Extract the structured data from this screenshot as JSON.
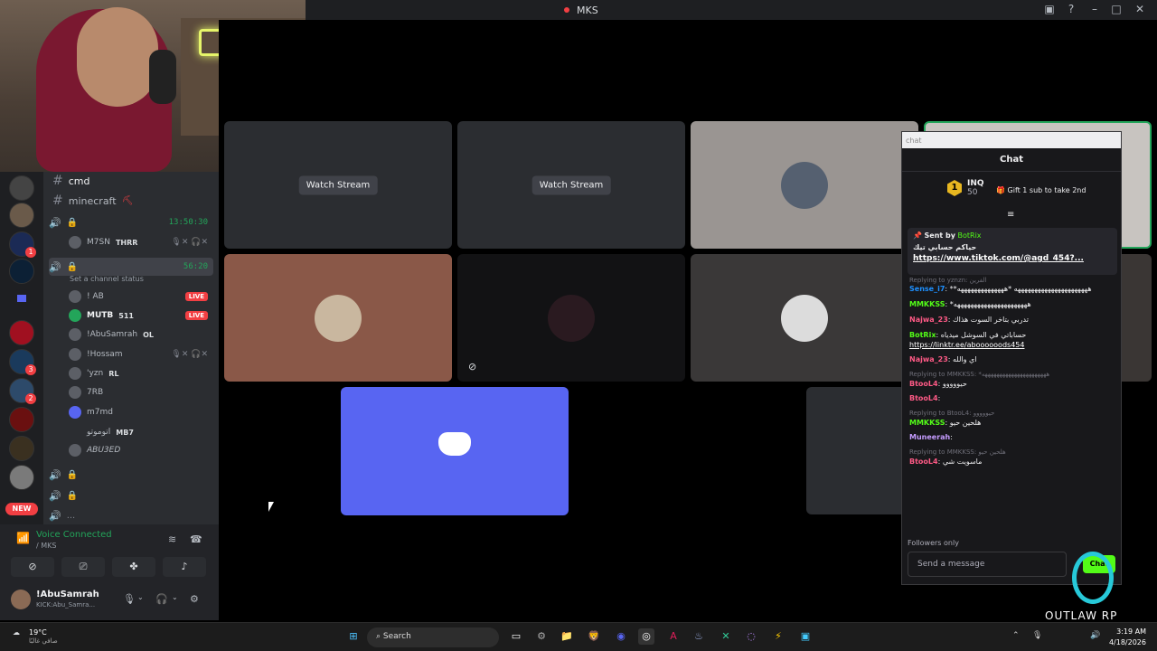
{
  "window": {
    "title": "MKS"
  },
  "channels": {
    "text": [
      {
        "name": "cmd"
      },
      {
        "name": "minecraft"
      }
    ],
    "voice1": {
      "time": "13:50:30",
      "members": [
        {
          "name": "M7SN",
          "tag": "THRR"
        }
      ]
    },
    "voice2": {
      "time": "56:20",
      "status_placeholder": "Set a channel status",
      "members": [
        {
          "name": "! AB",
          "live": "LIVE"
        },
        {
          "name": "MUTB",
          "tag": "511",
          "live": "LIVE"
        },
        {
          "name": "!AbuSamrah",
          "tag": "OL"
        },
        {
          "name": "!Hossam"
        },
        {
          "name": "'yzn",
          "tag": "RL"
        },
        {
          "name": "7RB"
        },
        {
          "name": "m7md"
        },
        {
          "name": "اتوموتو",
          "tag": "MB7"
        },
        {
          "name": "ABU3ED"
        }
      ]
    },
    "more": "..."
  },
  "servers": {
    "badges": [
      "1",
      "3",
      "2"
    ],
    "new_label": "NEW"
  },
  "voice_panel": {
    "status": "Voice Connected",
    "channel": "/ MKS"
  },
  "user_panel": {
    "name": "!AbuSamrah",
    "status": "KICK:Abu_Samra..."
  },
  "stage": {
    "watch_label": "Watch Stream"
  },
  "chat": {
    "window_label": "chat",
    "header": "Chat",
    "leaderboard": {
      "rank": "1",
      "name": "INQ",
      "count": "50"
    },
    "gift_text": "Gift 1 sub to take 2nd",
    "pinned": {
      "sent_by": "Sent by",
      "user": "BotRix",
      "message": "حياكم حسابي تيك",
      "link": "https://www.tiktok.com/@agd_454?..."
    },
    "messages": [
      {
        "reply": "Replying to yznzn: الفرين",
        "user": "Sense_i7",
        "color": "#1e90ff",
        "text": "**ههههههههههههههههههههههه *ههههههههههههههه"
      },
      {
        "user": "MMKKSS",
        "color": "#53fc18",
        "text": "*ههههههههههههههههههههههه"
      },
      {
        "user": "Najwa_23",
        "color": "#ff5a86",
        "text": "تدربي بتاخر السوت هذاك"
      },
      {
        "user": "BotRix",
        "color": "#53fc18",
        "text": "حساباتي في السوشل ميدياه",
        "link": "https://linktr.ee/aboooooods454"
      },
      {
        "user": "Najwa_23",
        "color": "#ff5a86",
        "text": "اي والله"
      },
      {
        "reply": "Replying to MMKKSS: *ههههههههههههههههههههههه",
        "user": "BtooL4",
        "color": "#ff5a86",
        "text": "حيووووو"
      },
      {
        "user": "BtooL4",
        "color": "#ff5a86",
        "text": ""
      },
      {
        "reply": "Replying to BtooL4: حيووووو",
        "user": "MMKKSS",
        "color": "#53fc18",
        "text": "هلحين حيو"
      },
      {
        "user": "Muneerah",
        "color": "#c59cff",
        "text": ""
      },
      {
        "reply": "Replying to MMKKSS: هلحين حيو",
        "user": "BtooL4",
        "color": "#ff5a86",
        "text": "ماسويت شي"
      }
    ],
    "followers_only": "Followers only",
    "input_placeholder": "Send a message",
    "send": "Chat"
  },
  "overlay": {
    "brand": "OUTLAW RP"
  },
  "taskbar": {
    "weather_temp": "19°C",
    "weather_desc": "صافي غالبًا",
    "search": "Search",
    "time": "3:19 AM",
    "date": "4/18/2026"
  },
  "colors": {
    "discord_blurple": "#5865f2",
    "kick_green": "#53fc18",
    "live_red": "#f23f43",
    "voice_green": "#23a55a"
  }
}
